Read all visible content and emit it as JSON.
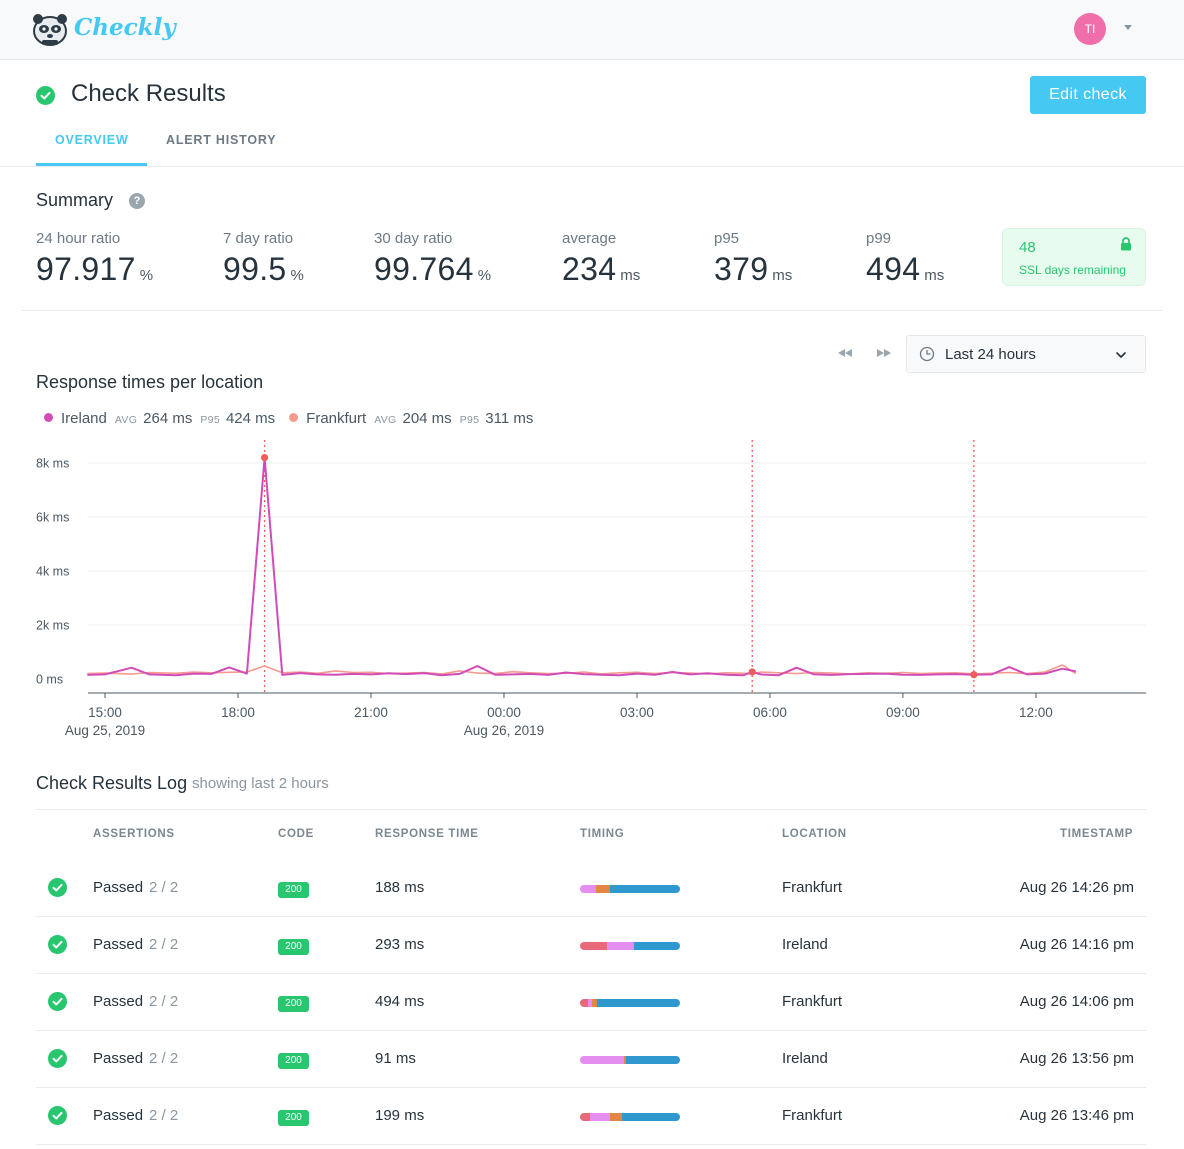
{
  "app": {
    "name": "Checkly",
    "user_initials": "TI"
  },
  "header": {
    "title": "Check Results",
    "edit_button": "Edit check",
    "tabs": [
      {
        "label": "OVERVIEW",
        "active": true
      },
      {
        "label": "ALERT HISTORY",
        "active": false
      }
    ]
  },
  "summary": {
    "title": "Summary",
    "help": "?",
    "stats": [
      {
        "label": "24 hour ratio",
        "value": "97.917",
        "unit": "%"
      },
      {
        "label": "7 day ratio",
        "value": "99.5",
        "unit": "%"
      },
      {
        "label": "30 day ratio",
        "value": "99.764",
        "unit": "%"
      },
      {
        "label": "average",
        "value": "234",
        "unit": "ms"
      },
      {
        "label": "p95",
        "value": "379",
        "unit": "ms"
      },
      {
        "label": "p99",
        "value": "494",
        "unit": "ms"
      }
    ],
    "ssl": {
      "days": "48",
      "label": "SSL days remaining"
    }
  },
  "chart_controls": {
    "range": "Last 24 hours"
  },
  "chart_section": {
    "title": "Response times per location",
    "legend": [
      {
        "name": "Ireland",
        "avg_tag": "AVG",
        "avg": "264 ms",
        "p95_tag": "P95",
        "p95": "424 ms",
        "color": "#d14cb7"
      },
      {
        "name": "Frankfurt",
        "avg_tag": "AVG",
        "avg": "204 ms",
        "p95_tag": "P95",
        "p95": "311 ms",
        "color": "#f59a8e"
      }
    ]
  },
  "chart_data": {
    "type": "line",
    "ylim": [
      0,
      8500
    ],
    "y_ticks": [
      {
        "value": 0,
        "label": "0 ms"
      },
      {
        "value": 2000,
        "label": "2k ms"
      },
      {
        "value": 4000,
        "label": "4k ms"
      },
      {
        "value": 6000,
        "label": "6k ms"
      },
      {
        "value": 8000,
        "label": "8k ms"
      }
    ],
    "x_range_hours": [
      -2.0,
      21.9
    ],
    "x_ticks": [
      {
        "hour": 0,
        "label": "15:00",
        "sublabel": "Aug 25, 2019"
      },
      {
        "hour": 3,
        "label": "18:00",
        "sublabel": ""
      },
      {
        "hour": 6,
        "label": "21:00",
        "sublabel": ""
      },
      {
        "hour": 9,
        "label": "00:00",
        "sublabel": "Aug 26, 2019"
      },
      {
        "hour": 12,
        "label": "03:00",
        "sublabel": ""
      },
      {
        "hour": 15,
        "label": "06:00",
        "sublabel": ""
      },
      {
        "hour": 18,
        "label": "09:00",
        "sublabel": ""
      },
      {
        "hour": 21,
        "label": "12:00",
        "sublabel": ""
      }
    ],
    "failure_markers_hours": [
      3.6,
      14.6,
      19.6
    ],
    "marker_color": "#f25c5c",
    "series": [
      {
        "name": "Ireland",
        "color": "#d14cb7",
        "x": [
          -0.4,
          0.0,
          0.6,
          1.0,
          1.6,
          2.0,
          2.4,
          2.8,
          3.2,
          3.6,
          4.0,
          4.4,
          4.8,
          5.2,
          5.6,
          6.0,
          6.4,
          6.8,
          7.2,
          7.6,
          8.0,
          8.4,
          8.8,
          9.2,
          9.6,
          10.0,
          10.4,
          10.8,
          11.2,
          11.6,
          12.0,
          12.4,
          12.8,
          13.2,
          13.6,
          14.0,
          14.4,
          14.6,
          14.8,
          15.2,
          15.6,
          16.0,
          16.4,
          16.8,
          17.2,
          17.6,
          18.0,
          18.4,
          18.8,
          19.2,
          19.6,
          20.0,
          20.4,
          20.8,
          21.2,
          21.6,
          21.9
        ],
        "y": [
          150,
          170,
          420,
          170,
          140,
          200,
          190,
          430,
          200,
          8200,
          150,
          220,
          170,
          160,
          190,
          170,
          210,
          180,
          220,
          140,
          190,
          480,
          160,
          170,
          190,
          150,
          240,
          180,
          160,
          140,
          200,
          160,
          260,
          170,
          210,
          160,
          140,
          260,
          170,
          140,
          420,
          170,
          150,
          180,
          190,
          200,
          160,
          150,
          170,
          180,
          160,
          170,
          440,
          170,
          200,
          380,
          280
        ]
      },
      {
        "name": "Frankfurt",
        "color": "#f59a8e",
        "x": [
          -0.4,
          0.0,
          0.6,
          1.0,
          1.6,
          2.0,
          2.4,
          2.8,
          3.2,
          3.6,
          4.0,
          4.4,
          4.8,
          5.2,
          5.6,
          6.0,
          6.4,
          6.8,
          7.2,
          7.6,
          8.0,
          8.4,
          8.8,
          9.2,
          9.6,
          10.0,
          10.4,
          10.8,
          11.2,
          11.6,
          12.0,
          12.4,
          12.8,
          13.2,
          13.6,
          14.0,
          14.4,
          14.6,
          14.8,
          15.2,
          15.6,
          16.0,
          16.4,
          16.8,
          17.2,
          17.6,
          18.0,
          18.4,
          18.8,
          19.2,
          19.6,
          20.0,
          20.4,
          20.8,
          21.2,
          21.6,
          21.9
        ],
        "y": [
          200,
          220,
          180,
          240,
          210,
          260,
          230,
          250,
          260,
          480,
          230,
          260,
          210,
          300,
          240,
          250,
          200,
          220,
          240,
          190,
          300,
          220,
          200,
          270,
          230,
          200,
          210,
          260,
          190,
          230,
          250,
          200,
          240,
          220,
          180,
          230,
          210,
          200,
          260,
          230,
          200,
          240,
          220,
          190,
          230,
          210,
          240,
          200,
          220,
          230,
          190,
          210,
          240,
          200,
          260,
          520,
          200
        ]
      }
    ]
  },
  "log": {
    "title": "Check Results Log",
    "subtitle": "showing last 2 hours",
    "columns": [
      "ASSERTIONS",
      "CODE",
      "RESPONSE TIME",
      "TIMING",
      "LOCATION",
      "TIMESTAMP"
    ],
    "timing_colors": {
      "a": "#e86a7a",
      "b": "#e48ff0",
      "c": "#e28743",
      "d": "#2f98cf"
    },
    "rows": [
      {
        "status": "Passed",
        "assertions": "2 / 2",
        "code": "200",
        "response_time": "188 ms",
        "location": "Frankfurt",
        "timestamp": "Aug 26 14:26 pm",
        "timing": [
          [
            "b",
            0.16
          ],
          [
            "c",
            0.14
          ],
          [
            "d",
            0.7
          ]
        ]
      },
      {
        "status": "Passed",
        "assertions": "2 / 2",
        "code": "200",
        "response_time": "293 ms",
        "location": "Ireland",
        "timestamp": "Aug 26 14:16 pm",
        "timing": [
          [
            "a",
            0.27
          ],
          [
            "b",
            0.27
          ],
          [
            "d",
            0.46
          ]
        ]
      },
      {
        "status": "Passed",
        "assertions": "2 / 2",
        "code": "200",
        "response_time": "494 ms",
        "location": "Frankfurt",
        "timestamp": "Aug 26 14:06 pm",
        "timing": [
          [
            "a",
            0.08
          ],
          [
            "b",
            0.04
          ],
          [
            "c",
            0.05
          ],
          [
            "d",
            0.83
          ]
        ]
      },
      {
        "status": "Passed",
        "assertions": "2 / 2",
        "code": "200",
        "response_time": "91 ms",
        "location": "Ireland",
        "timestamp": "Aug 26 13:56 pm",
        "timing": [
          [
            "b",
            0.44
          ],
          [
            "c",
            0.02
          ],
          [
            "d",
            0.54
          ]
        ]
      },
      {
        "status": "Passed",
        "assertions": "2 / 2",
        "code": "200",
        "response_time": "199 ms",
        "location": "Frankfurt",
        "timestamp": "Aug 26 13:46 pm",
        "timing": [
          [
            "a",
            0.1
          ],
          [
            "b",
            0.2
          ],
          [
            "c",
            0.12
          ],
          [
            "d",
            0.58
          ]
        ]
      }
    ]
  }
}
